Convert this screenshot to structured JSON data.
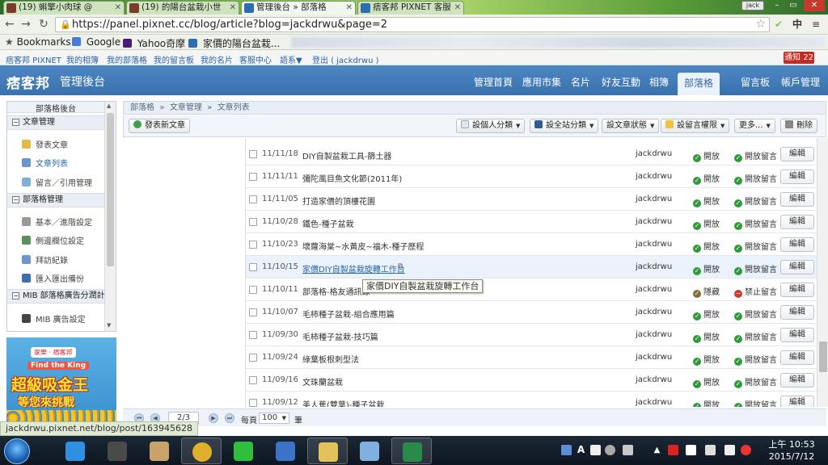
{
  "browser": {
    "tabs": [
      {
        "label": "(19) 蝌擎小肉球 @",
        "active": false
      },
      {
        "label": "(19) 的陽台盆栽小世",
        "active": false
      },
      {
        "label": "管理後台 » 部落格",
        "active": true
      },
      {
        "label": "痞客邦 PIXNET 客服",
        "active": false
      }
    ],
    "profile_label": "jack",
    "url": "https://panel.pixnet.cc/blog/article?blog=jackdrwu&page=2",
    "ime_label": "中",
    "bookmarks": [
      {
        "label": "Bookmarks",
        "icon": "star-icon"
      },
      {
        "label": "Google",
        "icon": "google-icon"
      },
      {
        "label": "Yahoo奇摩",
        "icon": "yahoo-icon"
      },
      {
        "label": "家價的陽台盆栽...",
        "icon": "pixnet-icon"
      }
    ]
  },
  "top_links": {
    "items": [
      "痞客邦 PIXNET",
      "我的相簿",
      "我的部落格",
      "我的留言板",
      "我的名片",
      "客服中心",
      "語系▼",
      "登出 ( jackdrwu )"
    ],
    "notify_label": "通知 22"
  },
  "header": {
    "logo": "痞客邦",
    "title": "管理後台",
    "nav": [
      "管理首頁",
      "應用市集",
      "名片",
      "好友互動",
      "相簿",
      "部落格",
      "留言板",
      "帳戶管理"
    ],
    "active_nav": "部落格"
  },
  "sidebar": {
    "title": "部落格後台",
    "sections": [
      {
        "label": "文章管理",
        "items": [
          "發表文章",
          "文章列表",
          "留言／引用管理"
        ]
      },
      {
        "label": "部落格管理",
        "items": [
          "基本／進階設定",
          "側邊欄位設定",
          "拜訪紀錄",
          "匯入匯出備份"
        ]
      },
      {
        "label": "MIB 部落格廣告分潤計畫",
        "items": [
          "MIB 廣告設定"
        ]
      }
    ]
  },
  "ad": {
    "brand_left": "家樂",
    "brand_right": "痞客邦",
    "headline": "Find the King",
    "big_text": "超級吸金王",
    "sub_text": "等您來挑戰"
  },
  "breadcrumb": [
    "部落格",
    "»",
    "文章管理",
    "»",
    "文章列表"
  ],
  "actions": {
    "new_post": "發表新文章",
    "personal_category": "設個人分類",
    "site_category": "設全站分類",
    "post_status": "設文章狀態",
    "comment_permission": "設留言權限",
    "more": "更多...",
    "delete": "刪除"
  },
  "articles": [
    {
      "date": "11/11/18",
      "title": "DIY自製盆栽工具-篩土器",
      "author": "jackdrwu",
      "status": "開放",
      "comment": "開放留言",
      "status_color": "#2e9a3a",
      "comment_color": "#2e9a3a"
    },
    {
      "date": "11/11/11",
      "title": "彌陀風目魚文化節(2011年)",
      "author": "jackdrwu",
      "status": "開放",
      "comment": "開放留言",
      "status_color": "#2e9a3a",
      "comment_color": "#2e9a3a"
    },
    {
      "date": "11/11/05",
      "title": "打造家價的頂樓花園",
      "author": "jackdrwu",
      "status": "開放",
      "comment": "開放留言",
      "status_color": "#2e9a3a",
      "comment_color": "#2e9a3a"
    },
    {
      "date": "11/10/28",
      "title": "鐵色-種子盆栽",
      "author": "jackdrwu",
      "status": "開放",
      "comment": "開放留言",
      "status_color": "#2e9a3a",
      "comment_color": "#2e9a3a"
    },
    {
      "date": "11/10/23",
      "title": "壞蘿海棠~水黃皮~福木-種子歷程",
      "author": "jackdrwu",
      "status": "開放",
      "comment": "開放留言",
      "status_color": "#2e9a3a",
      "comment_color": "#2e9a3a"
    },
    {
      "date": "11/10/15",
      "title": "家價DIY自製盆栽旋轉工作台",
      "author": "jackdrwu",
      "status": "開放",
      "comment": "開放留言",
      "status_color": "#2e9a3a",
      "comment_color": "#2e9a3a",
      "hover": true
    },
    {
      "date": "11/10/11",
      "title": "部落格-格友通訊錄",
      "author": "jackdrwu",
      "status": "隱藏",
      "comment": "禁止留言",
      "status_color": "#8a6a3a",
      "comment_color": "#d23a2a"
    },
    {
      "date": "11/10/07",
      "title": "毛柿種子盆栽-組合應用篇",
      "author": "jackdrwu",
      "status": "開放",
      "comment": "開放留言",
      "status_color": "#2e9a3a",
      "comment_color": "#2e9a3a"
    },
    {
      "date": "11/09/30",
      "title": "毛柿種子盆栽-技巧篇",
      "author": "jackdrwu",
      "status": "開放",
      "comment": "開放留言",
      "status_color": "#2e9a3a",
      "comment_color": "#2e9a3a"
    },
    {
      "date": "11/09/24",
      "title": "綠葉板根刺型法",
      "author": "jackdrwu",
      "status": "開放",
      "comment": "開放留言",
      "status_color": "#2e9a3a",
      "comment_color": "#2e9a3a"
    },
    {
      "date": "11/09/16",
      "title": "文珠蘭盆栽",
      "author": "jackdrwu",
      "status": "開放",
      "comment": "開放留言",
      "status_color": "#2e9a3a",
      "comment_color": "#2e9a3a"
    },
    {
      "date": "11/09/12",
      "title": "美人蕉(雙葉)-種子盆栽",
      "author": "jackdrwu",
      "status": "開放",
      "comment": "開放留言",
      "status_color": "#2e9a3a",
      "comment_color": "#2e9a3a"
    }
  ],
  "edit_label": "編輯",
  "tooltip": "家價DIY自製盆栽旋轉工作台",
  "pagination": {
    "page_value": "2/3",
    "per_page_label": "每頁",
    "per_page_value": "100",
    "per_page_unit": "筆"
  },
  "status_url": "jackdrwu.pixnet.net/blog/post/163945628",
  "taskbar": {
    "apps": [
      "internet-explorer",
      "photoscape",
      "paint",
      "chrome",
      "line",
      "remote",
      "file-explorer",
      "notes",
      "excel"
    ],
    "clock_time": "上午 10:53",
    "clock_date": "2015/7/12",
    "tray_ime": "A"
  }
}
